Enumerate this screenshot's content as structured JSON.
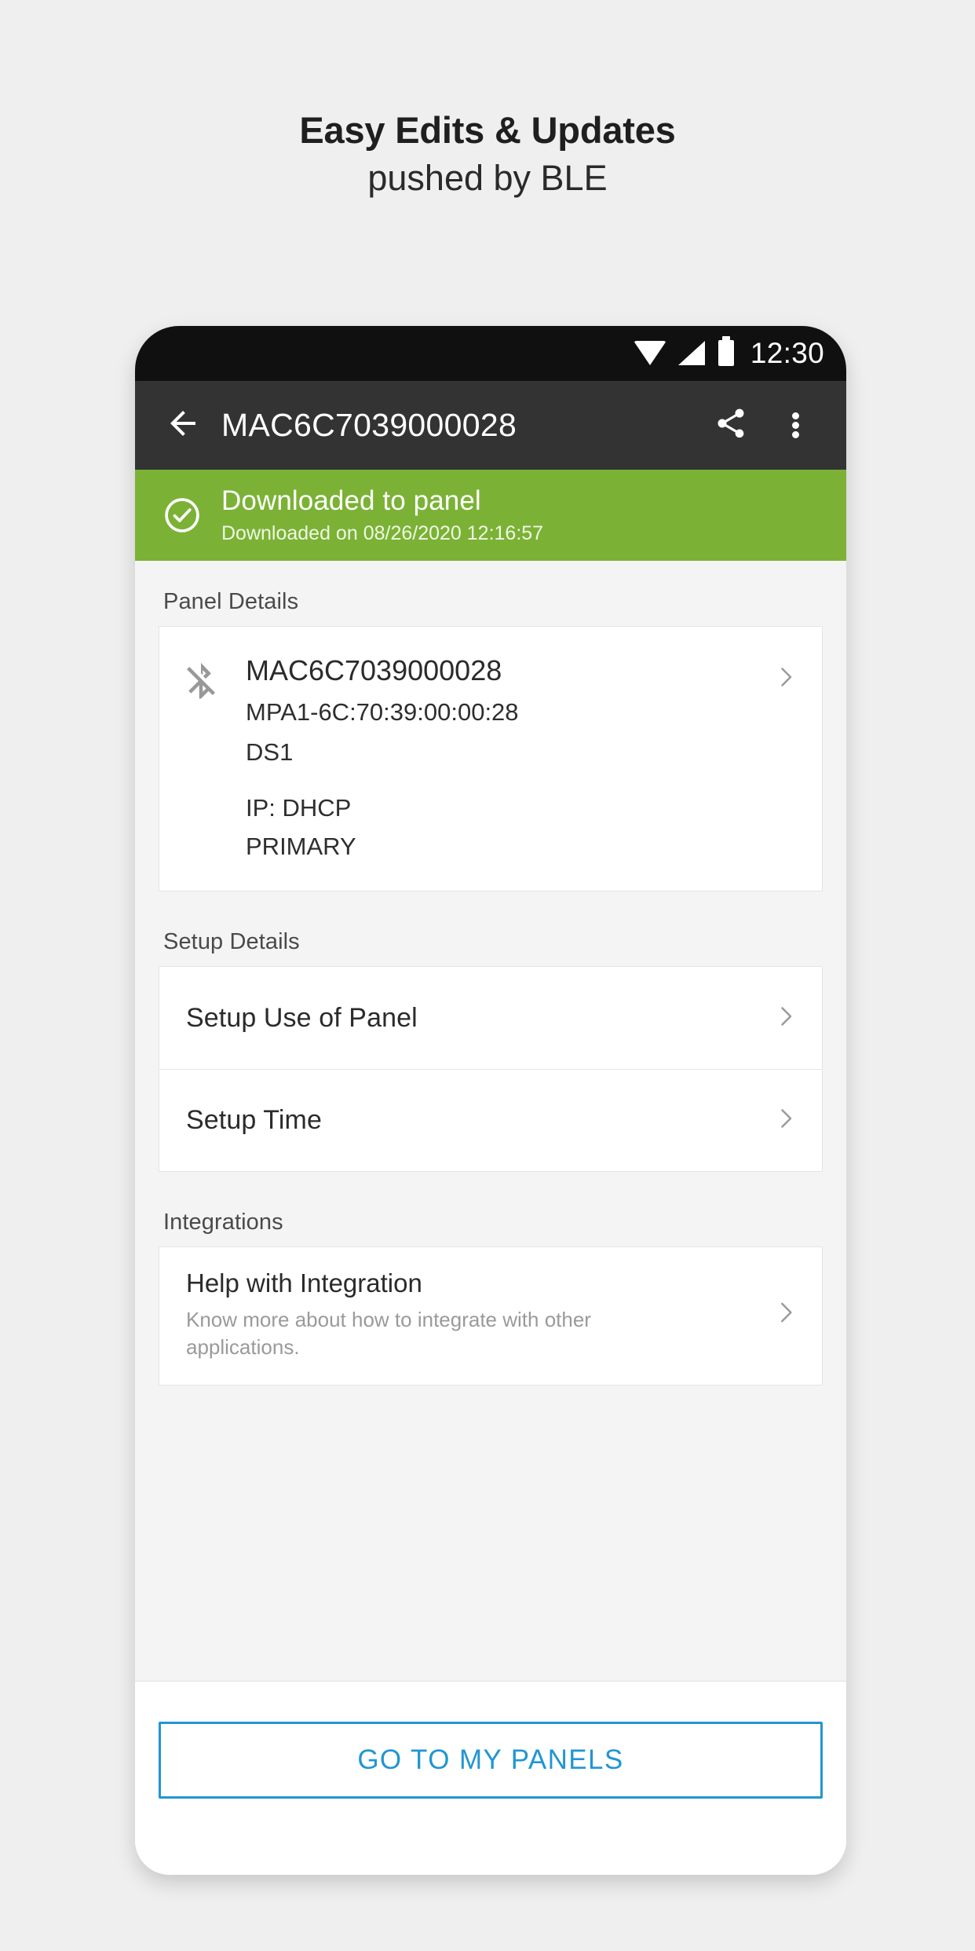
{
  "promo": {
    "line1": "Easy Edits & Updates",
    "line2": "pushed by BLE"
  },
  "statusbar": {
    "time": "12:30",
    "icons": [
      "wifi-icon",
      "cellular-signal-icon",
      "battery-icon"
    ]
  },
  "appbar": {
    "back_icon": "arrow-back-icon",
    "title": "MAC6C7039000028",
    "share_icon": "share-icon",
    "overflow_icon": "more-vert-icon"
  },
  "banner": {
    "icon": "check-circle-icon",
    "title": "Downloaded to panel",
    "subtitle": "Downloaded on  08/26/2020 12:16:57",
    "background_color": "#7BB236"
  },
  "sections": {
    "panel_details": {
      "label": "Panel Details",
      "icon": "bluetooth-disabled-icon",
      "name": "MAC6C7039000028",
      "mac": "MPA1-6C:70:39:00:00:28",
      "ds": "DS1",
      "ip": "IP: DHCP",
      "role": "PRIMARY",
      "chevron_icon": "chevron-right-icon"
    },
    "setup_details": {
      "label": "Setup Details",
      "rows": [
        {
          "label": "Setup Use of Panel",
          "chevron_icon": "chevron-right-icon"
        },
        {
          "label": "Setup Time",
          "chevron_icon": "chevron-right-icon"
        }
      ]
    },
    "integrations": {
      "label": "Integrations",
      "title": "Help with Integration",
      "description": "Know more about how to integrate with other applications.",
      "chevron_icon": "chevron-right-icon"
    }
  },
  "bottom_bar": {
    "primary_button": "GO TO MY PANELS",
    "accent_color": "#2196D3"
  }
}
